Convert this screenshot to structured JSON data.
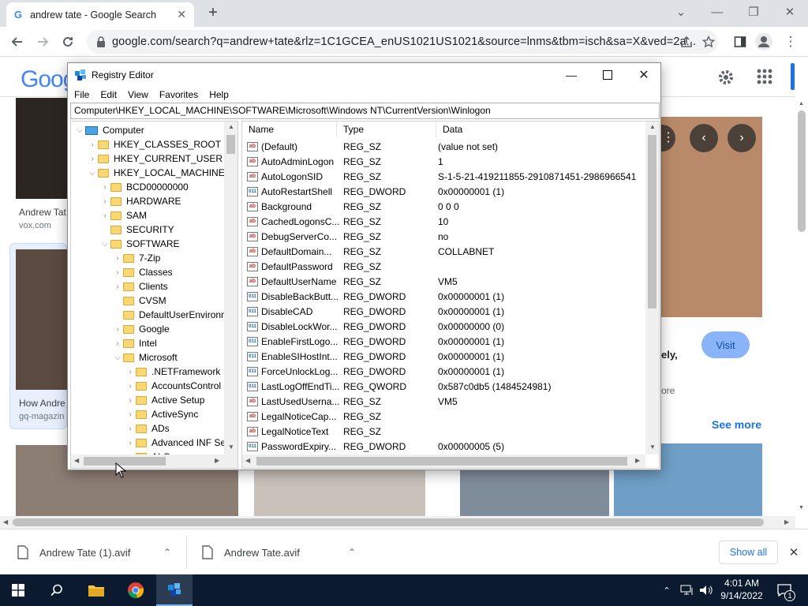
{
  "browser": {
    "tab_title": "andrew tate - Google Search",
    "tab_close": "✕",
    "new_tab": "+",
    "url": "google.com/search?q=andrew+tate&rlz=1C1GCEA_enUS1021US1021&source=lnms&tbm=isch&sa=X&ved=2a..."
  },
  "page": {
    "logo": "Goog",
    "results": [
      {
        "caption": "Andrew Tat",
        "source": "vox.com"
      },
      {
        "caption": "How Andre",
        "source": "gq-magazin"
      }
    ],
    "panel": {
      "visit": "Visit",
      "snippet_1": "ely,",
      "snippet_2": "ore",
      "see_more": "See more"
    }
  },
  "registry": {
    "title": "Registry Editor",
    "menu": [
      "File",
      "Edit",
      "View",
      "Favorites",
      "Help"
    ],
    "address": "Computer\\HKEY_LOCAL_MACHINE\\SOFTWARE\\Microsoft\\Windows NT\\CurrentVersion\\Winlogon",
    "tree": [
      {
        "label": "Computer",
        "depth": 0,
        "chev": "v",
        "kind": "computer"
      },
      {
        "label": "HKEY_CLASSES_ROOT",
        "depth": 1,
        "chev": ">"
      },
      {
        "label": "HKEY_CURRENT_USER",
        "depth": 1,
        "chev": ">"
      },
      {
        "label": "HKEY_LOCAL_MACHINE",
        "depth": 1,
        "chev": "v"
      },
      {
        "label": "BCD00000000",
        "depth": 2,
        "chev": ">"
      },
      {
        "label": "HARDWARE",
        "depth": 2,
        "chev": ">"
      },
      {
        "label": "SAM",
        "depth": 2,
        "chev": ">"
      },
      {
        "label": "SECURITY",
        "depth": 2,
        "chev": ""
      },
      {
        "label": "SOFTWARE",
        "depth": 2,
        "chev": "v"
      },
      {
        "label": "7-Zip",
        "depth": 3,
        "chev": ">"
      },
      {
        "label": "Classes",
        "depth": 3,
        "chev": ">"
      },
      {
        "label": "Clients",
        "depth": 3,
        "chev": ">"
      },
      {
        "label": "CVSM",
        "depth": 3,
        "chev": ""
      },
      {
        "label": "DefaultUserEnvironn",
        "depth": 3,
        "chev": ""
      },
      {
        "label": "Google",
        "depth": 3,
        "chev": ">"
      },
      {
        "label": "Intel",
        "depth": 3,
        "chev": ">"
      },
      {
        "label": "Microsoft",
        "depth": 3,
        "chev": "v"
      },
      {
        "label": ".NETFramework",
        "depth": 4,
        "chev": ">"
      },
      {
        "label": "AccountsControl",
        "depth": 4,
        "chev": ">"
      },
      {
        "label": "Active Setup",
        "depth": 4,
        "chev": ">"
      },
      {
        "label": "ActiveSync",
        "depth": 4,
        "chev": ">"
      },
      {
        "label": "ADs",
        "depth": 4,
        "chev": ">"
      },
      {
        "label": "Advanced INF Set",
        "depth": 4,
        "chev": ">"
      },
      {
        "label": "ALG",
        "depth": 4,
        "chev": ">"
      }
    ],
    "columns": {
      "name": "Name",
      "type": "Type",
      "data": "Data"
    },
    "values": [
      {
        "name": "(Default)",
        "type": "REG_SZ",
        "data": "(value not set)",
        "icon": "ab"
      },
      {
        "name": "AutoAdminLogon",
        "type": "REG_SZ",
        "data": "1",
        "icon": "ab"
      },
      {
        "name": "AutoLogonSID",
        "type": "REG_SZ",
        "data": "S-1-5-21-419211855-2910871451-2986966541",
        "icon": "ab"
      },
      {
        "name": "AutoRestartShell",
        "type": "REG_DWORD",
        "data": "0x00000001 (1)",
        "icon": "011"
      },
      {
        "name": "Background",
        "type": "REG_SZ",
        "data": "0 0 0",
        "icon": "ab"
      },
      {
        "name": "CachedLogonsC...",
        "type": "REG_SZ",
        "data": "10",
        "icon": "ab"
      },
      {
        "name": "DebugServerCo...",
        "type": "REG_SZ",
        "data": "no",
        "icon": "ab"
      },
      {
        "name": "DefaultDomain...",
        "type": "REG_SZ",
        "data": "COLLABNET",
        "icon": "ab"
      },
      {
        "name": "DefaultPassword",
        "type": "REG_SZ",
        "data": "",
        "icon": "ab"
      },
      {
        "name": "DefaultUserName",
        "type": "REG_SZ",
        "data": "VM5",
        "icon": "ab"
      },
      {
        "name": "DisableBackButt...",
        "type": "REG_DWORD",
        "data": "0x00000001 (1)",
        "icon": "011"
      },
      {
        "name": "DisableCAD",
        "type": "REG_DWORD",
        "data": "0x00000001 (1)",
        "icon": "011"
      },
      {
        "name": "DisableLockWor...",
        "type": "REG_DWORD",
        "data": "0x00000000 (0)",
        "icon": "011"
      },
      {
        "name": "EnableFirstLogo...",
        "type": "REG_DWORD",
        "data": "0x00000001 (1)",
        "icon": "011"
      },
      {
        "name": "EnableSIHostInt...",
        "type": "REG_DWORD",
        "data": "0x00000001 (1)",
        "icon": "011"
      },
      {
        "name": "ForceUnlockLog...",
        "type": "REG_DWORD",
        "data": "0x00000001 (1)",
        "icon": "011"
      },
      {
        "name": "LastLogOffEndTi...",
        "type": "REG_QWORD",
        "data": "0x587c0db5 (1484524981)",
        "icon": "011"
      },
      {
        "name": "LastUsedUserna...",
        "type": "REG_SZ",
        "data": "VM5",
        "icon": "ab"
      },
      {
        "name": "LegalNoticeCap...",
        "type": "REG_SZ",
        "data": "",
        "icon": "ab"
      },
      {
        "name": "LegalNoticeText",
        "type": "REG_SZ",
        "data": "",
        "icon": "ab"
      },
      {
        "name": "PasswordExpiry...",
        "type": "REG_DWORD",
        "data": "0x00000005 (5)",
        "icon": "011"
      }
    ]
  },
  "downloads": {
    "items": [
      "Andrew Tate (1).avif",
      "Andrew Tate.avif"
    ],
    "show_all": "Show all"
  },
  "taskbar": {
    "time": "4:01 AM",
    "date": "9/14/2022",
    "notification_count": "1"
  },
  "colors": {
    "accent": "#1a73e8",
    "visit_button": "#8ab4f8",
    "taskbar": "#0b1a2e",
    "folder": "#f8d775"
  }
}
